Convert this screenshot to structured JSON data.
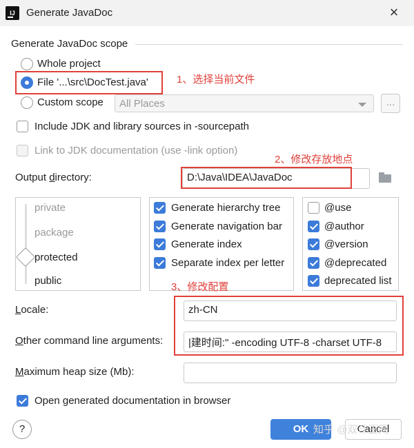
{
  "window": {
    "title": "Generate JavaDoc",
    "icon_text": "IJ"
  },
  "scope": {
    "group_label": "Generate JavaDoc scope",
    "whole_project": "Whole project",
    "file": "File '...\\src\\DocTest.java'",
    "custom_scope": "Custom scope",
    "custom_select_value": "All Places",
    "ellipsis": "..."
  },
  "options": {
    "include_jdk": "Include JDK and library sources in -sourcepath",
    "link_jdk": "Link to JDK documentation (use -link option)"
  },
  "output": {
    "label": "Output directory:",
    "value": "D:\\Java\\IDEA\\JavaDoc"
  },
  "levels": {
    "items": [
      "private",
      "package",
      "protected",
      "public"
    ],
    "selected": "protected"
  },
  "generate": {
    "items": [
      {
        "label": "Generate hierarchy tree",
        "checked": true
      },
      {
        "label": "Generate navigation bar",
        "checked": true
      },
      {
        "label": "Generate index",
        "checked": true
      },
      {
        "label": "Separate index per letter",
        "checked": true
      }
    ]
  },
  "tags": {
    "items": [
      {
        "label": "@use",
        "checked": false
      },
      {
        "label": "@author",
        "checked": true
      },
      {
        "label": "@version",
        "checked": true
      },
      {
        "label": "@deprecated",
        "checked": true
      },
      {
        "label": "deprecated list",
        "checked": true
      }
    ]
  },
  "locale": {
    "label": "Locale:",
    "value": "zh-CN"
  },
  "other_args": {
    "label": "Other command line arguments:",
    "value": "|建时间:\" -encoding UTF-8 -charset UTF-8"
  },
  "heap": {
    "label": "Maximum heap size (Mb):",
    "value": ""
  },
  "open_browser": {
    "label": "Open generated documentation in browser",
    "checked": true
  },
  "buttons": {
    "help": "?",
    "ok": "OK",
    "cancel": "Cancel"
  },
  "annotations": {
    "step1": "1、选择当前文件",
    "step2": "2、修改存放地点",
    "step3": "3、修改配置",
    "accent_color": "#e0403a"
  },
  "watermark": "知乎 @双斗王网"
}
